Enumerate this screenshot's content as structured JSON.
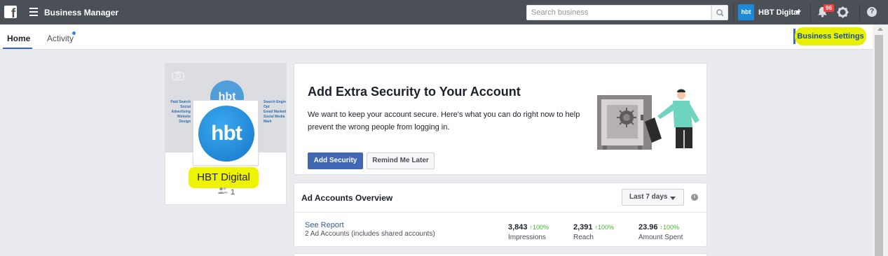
{
  "topbar": {
    "logo_letter": "f",
    "app_title": "Business Manager",
    "search_placeholder": "Search business",
    "account_name": "HBT Digital",
    "account_avatar_text": "hbt",
    "notification_count": "96",
    "help_label": "?"
  },
  "subnav": {
    "tabs": [
      {
        "label": "Home",
        "active": true
      },
      {
        "label": "Activity",
        "active": false
      }
    ],
    "business_settings_label": "Business Settings"
  },
  "business": {
    "name": "HBT Digital",
    "logo_text": "hbt",
    "member_count": "1",
    "cover_text_left": "Paid Search\nSocial Advertising\nWebsite Design",
    "cover_text_right": "Search Engine Opt\nEmail Marketi\nSocial Media Mark"
  },
  "security": {
    "title": "Add Extra Security to Your Account",
    "body": "We want to keep your account secure. Here's what you can do right now to help prevent the wrong people from logging in.",
    "primary_button": "Add Security",
    "secondary_button": "Remind Me Later"
  },
  "ad_accounts": {
    "title": "Ad Accounts Overview",
    "date_range": "Last 7 days",
    "info_icon": "i",
    "see_report": "See Report",
    "accounts_note": "2 Ad Accounts (includes shared accounts)",
    "metrics": [
      {
        "value": "3,843",
        "change": "↑100%",
        "label": "Impressions"
      },
      {
        "value": "2,391",
        "change": "↑100%",
        "label": "Reach"
      },
      {
        "value": "23.96",
        "change": "↑100%",
        "label": "Amount Spent"
      }
    ]
  },
  "colors": {
    "topbar": "#4b4f56",
    "primary": "#4267b2",
    "highlight": "#e6f000",
    "positive": "#42b72a"
  }
}
